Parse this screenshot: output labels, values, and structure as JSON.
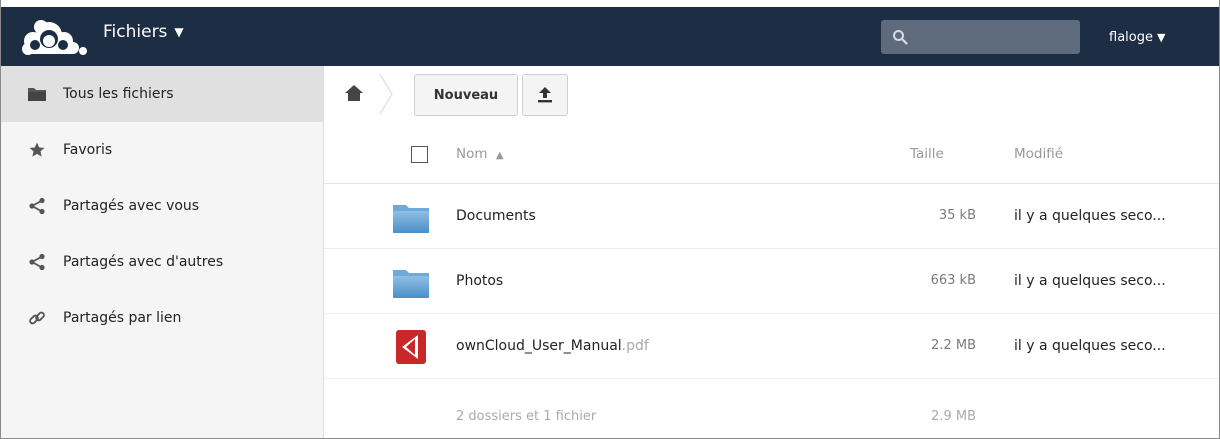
{
  "header": {
    "app_name": "Fichiers",
    "app_caret": "▼",
    "search_placeholder": "",
    "user": "flaloge",
    "user_caret": "▼",
    "colors": {
      "header_bg": "#1d2d44",
      "search_bg": "#5d6b7c"
    }
  },
  "sidebar": {
    "items": [
      {
        "label": "Tous les fichiers",
        "icon": "folder-icon",
        "active": true
      },
      {
        "label": "Favoris",
        "icon": "star-icon",
        "active": false
      },
      {
        "label": "Partagés avec vous",
        "icon": "share-icon",
        "active": false
      },
      {
        "label": "Partagés avec d'autres",
        "icon": "share-icon",
        "active": false
      },
      {
        "label": "Partagés par lien",
        "icon": "link-icon",
        "active": false
      }
    ]
  },
  "controls": {
    "new_label": "Nouveau",
    "upload_icon": "upload-icon",
    "home_icon": "home-icon"
  },
  "list": {
    "columns": {
      "name": "Nom",
      "sort_indicator": "▲",
      "size": "Taille",
      "modified": "Modifié"
    },
    "files": [
      {
        "name": "Documents",
        "ext": "",
        "type": "folder",
        "size": "35 kB",
        "modified": "il y a quelques seco..."
      },
      {
        "name": "Photos",
        "ext": "",
        "type": "folder",
        "size": "663 kB",
        "modified": "il y a quelques seco..."
      },
      {
        "name": "ownCloud_User_Manual",
        "ext": ".pdf",
        "type": "pdf",
        "size": "2.2 MB",
        "modified": "il y a quelques seco..."
      }
    ],
    "summary": {
      "text": "2 dossiers et 1 fichier",
      "size": "2.9 MB"
    }
  }
}
